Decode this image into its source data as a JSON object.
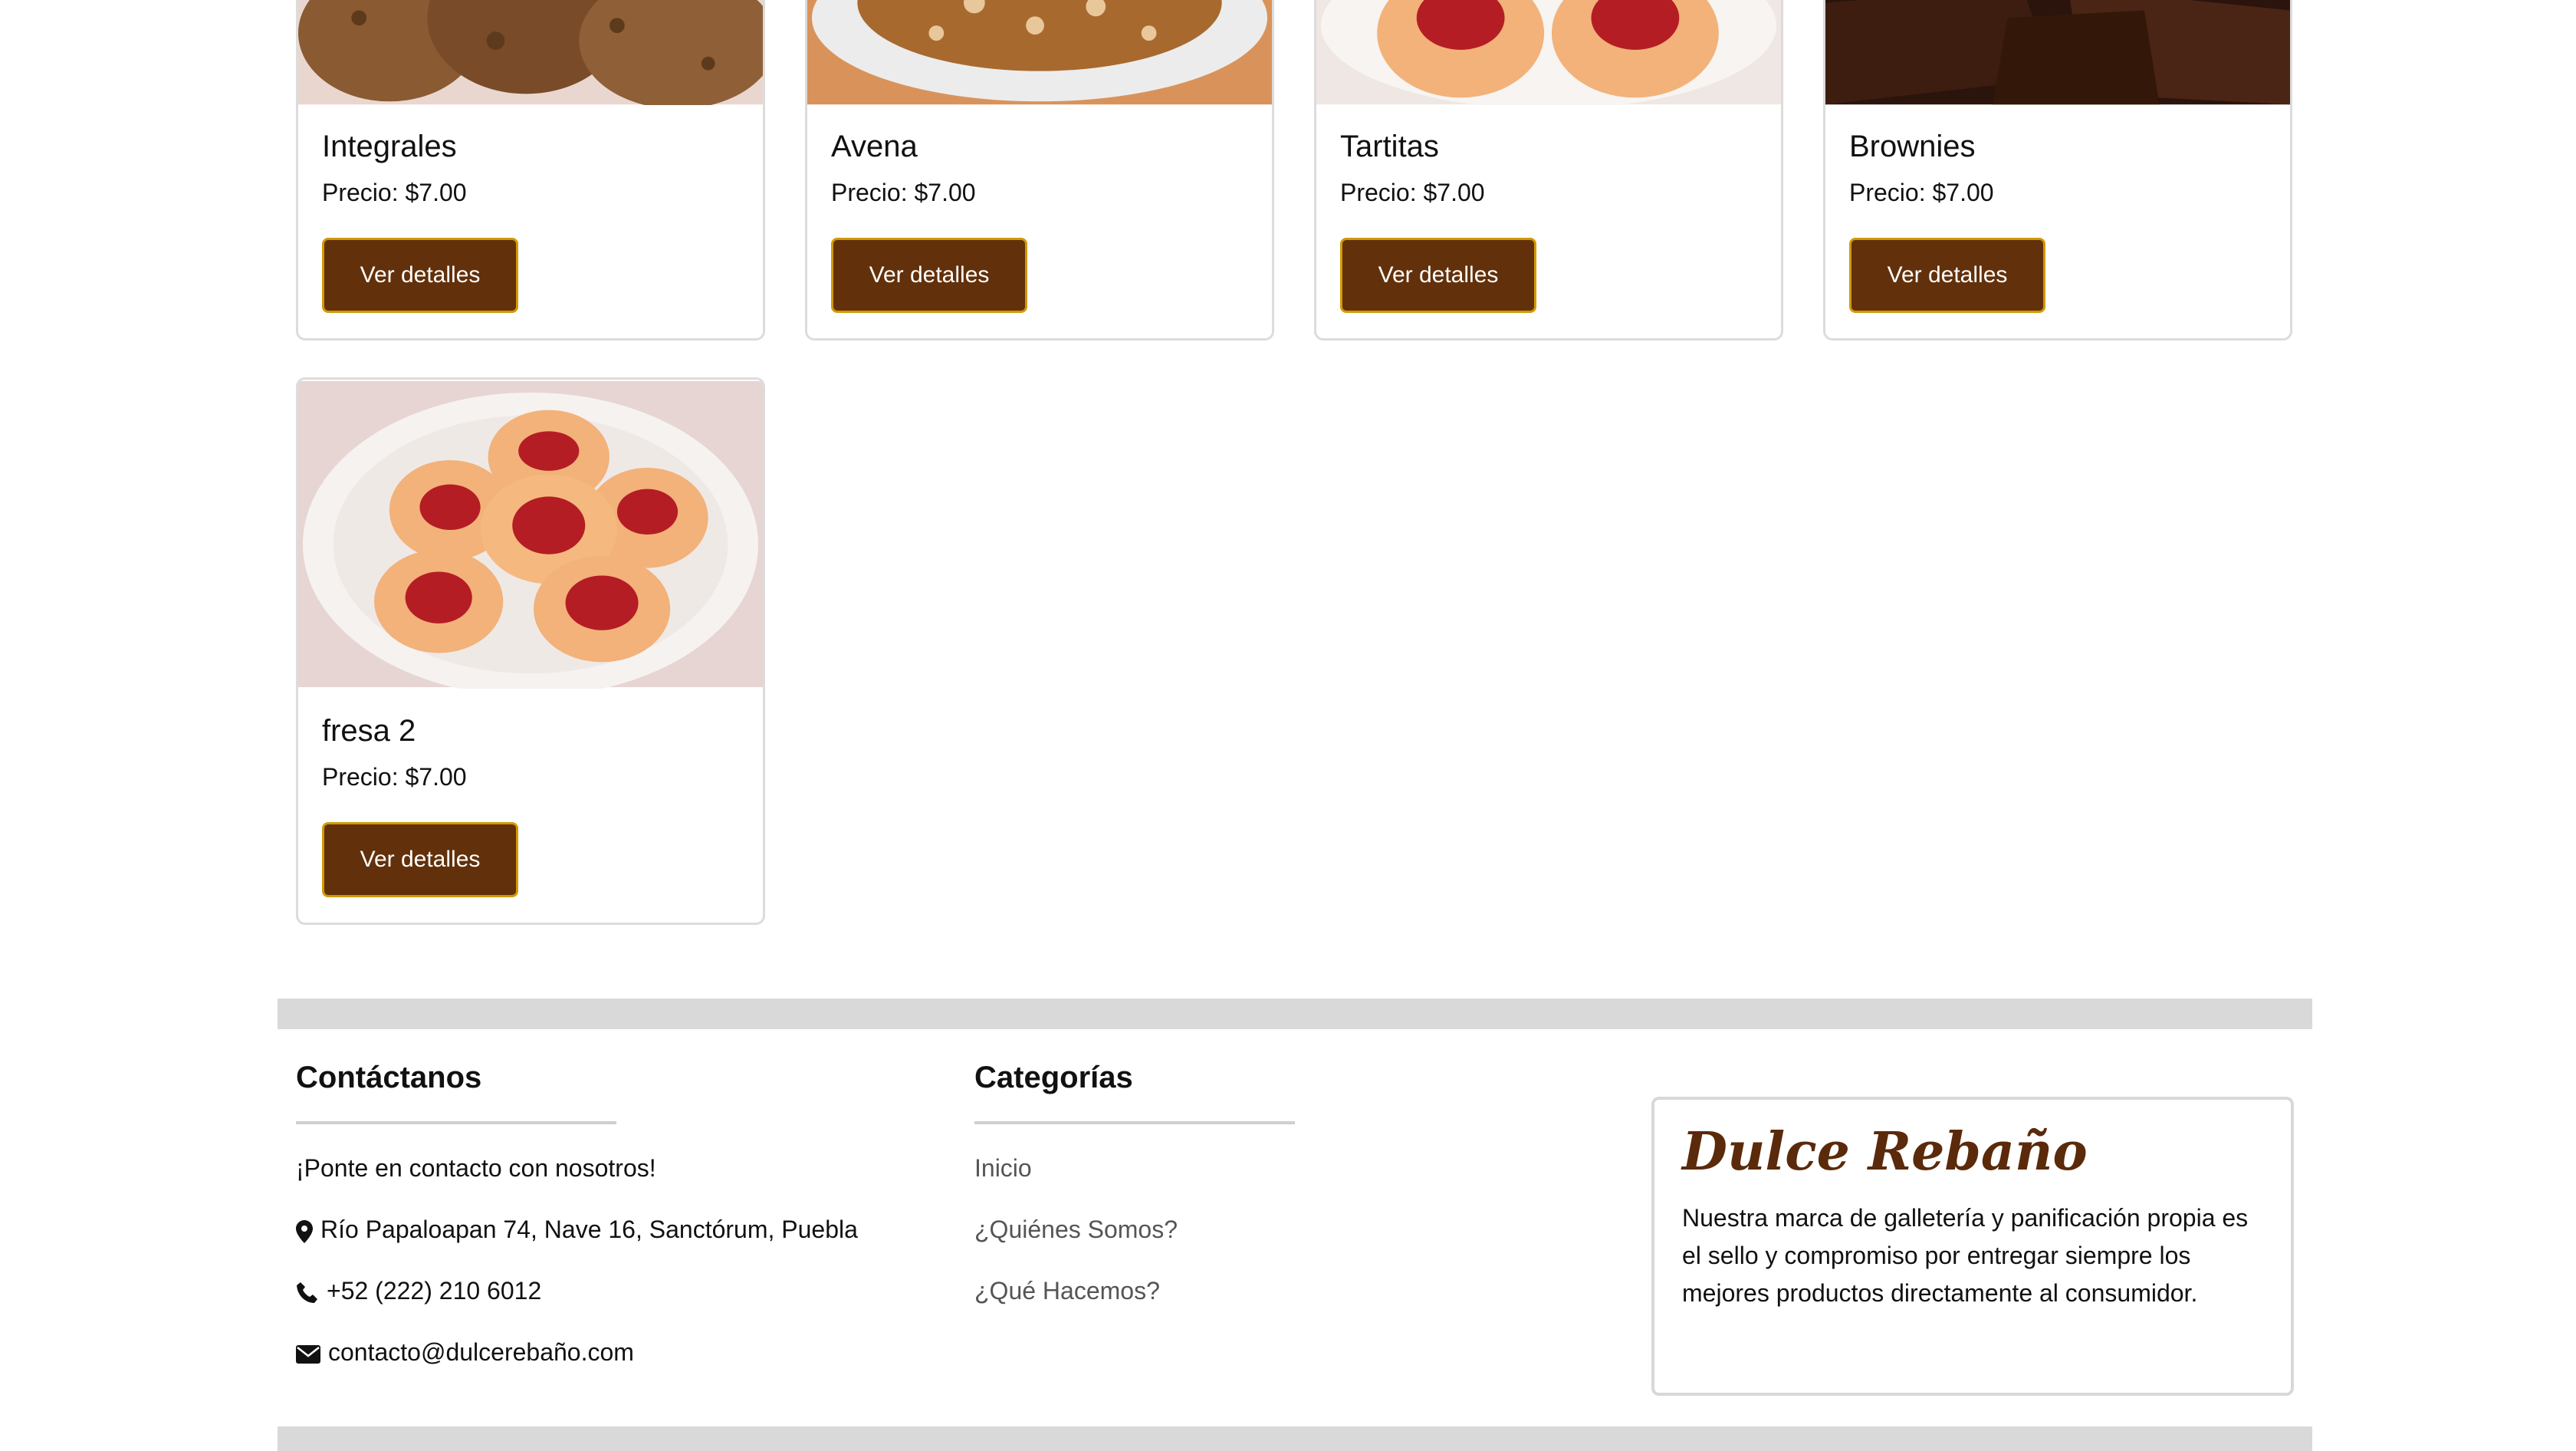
{
  "products": [
    {
      "name": "Integrales",
      "price": "Precio: $7.00",
      "button": "Ver detalles",
      "image": "integral-cookies-image"
    },
    {
      "name": "Avena",
      "price": "Precio: $7.00",
      "button": "Ver detalles",
      "image": "oat-cookies-image"
    },
    {
      "name": "Tartitas",
      "price": "Precio: $7.00",
      "button": "Ver detalles",
      "image": "jam-tart-cookies-image"
    },
    {
      "name": "Brownies",
      "price": "Precio: $7.00",
      "button": "Ver detalles",
      "image": "brownies-image"
    },
    {
      "name": "fresa 2",
      "price": "Precio: $7.00",
      "button": "Ver detalles",
      "image": "strawberry-cookies-image"
    }
  ],
  "footer": {
    "contact": {
      "heading": "Contáctanos",
      "intro": "¡Ponte en contacto con nosotros!",
      "address": "Río Papaloapan 74, Nave 16, Sanctórum, Puebla",
      "phone": "+52 (222) 210 6012",
      "email": "contacto@dulcerebaño.com"
    },
    "categories": {
      "heading": "Categorías",
      "links": [
        "Inicio",
        "¿Quiénes Somos?",
        "¿Qué Hacemos?"
      ]
    },
    "brand": {
      "name": "Dulce Rebaño",
      "description": "Nuestra marca de galletería y panificación propia es el sello y compromiso por entregar siempre los mejores productos directamente al consumidor."
    }
  },
  "colors": {
    "button_bg": "#62300a",
    "button_border": "#d19a00",
    "brand_text": "#5a2a0a",
    "footer_bar": "#d9d9d9"
  },
  "icons": [
    "map-marker-icon",
    "phone-icon",
    "envelope-icon"
  ]
}
